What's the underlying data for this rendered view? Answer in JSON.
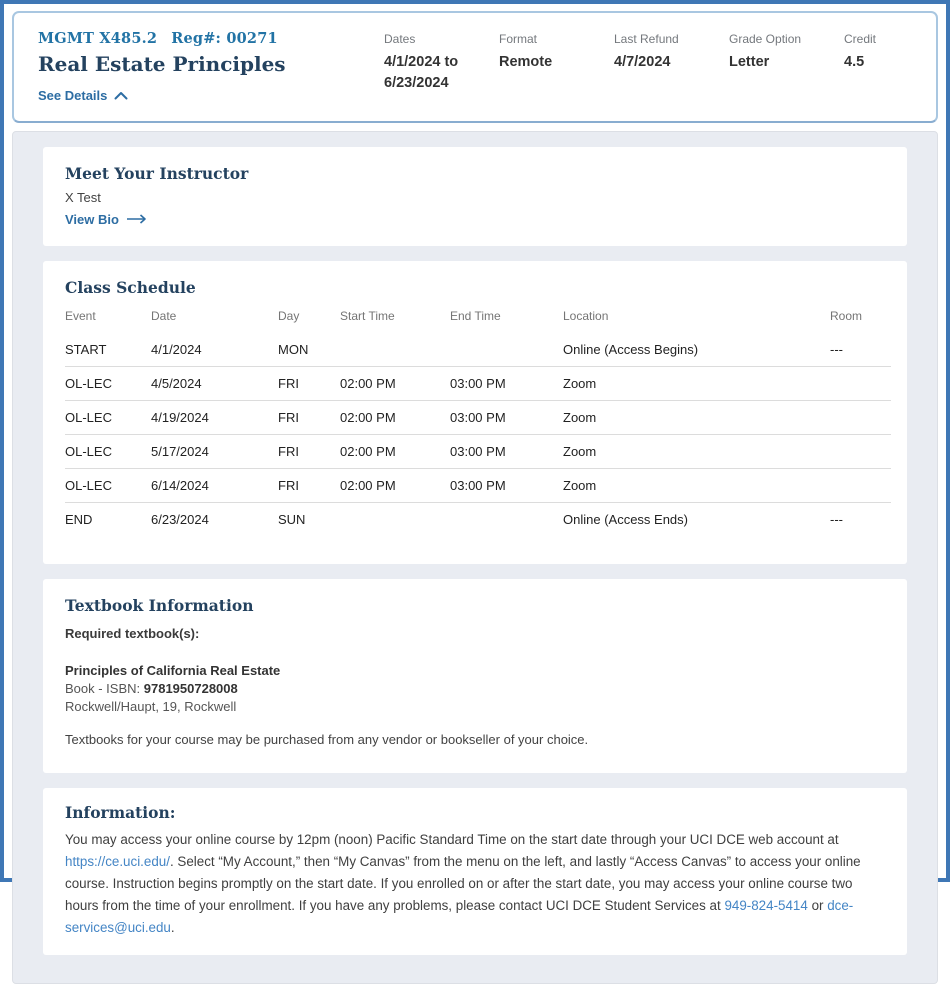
{
  "header": {
    "course_code": "MGMT X485.2",
    "reg_number": "Reg#: 00271",
    "course_title": "Real Estate Principles",
    "see_details_label": "See Details",
    "meta": [
      {
        "label": "Dates",
        "value": "4/1/2024 to 6/23/2024"
      },
      {
        "label": "Format",
        "value": "Remote"
      },
      {
        "label": "Last Refund",
        "value": "4/7/2024"
      },
      {
        "label": "Grade Option",
        "value": "Letter"
      },
      {
        "label": "Credit",
        "value": "4.5"
      }
    ]
  },
  "instructor": {
    "heading": "Meet Your Instructor",
    "name": "X Test",
    "view_bio_label": "View Bio"
  },
  "schedule": {
    "heading": "Class Schedule",
    "columns": [
      "Event",
      "Date",
      "Day",
      "Start Time",
      "End Time",
      "Location",
      "Room"
    ],
    "rows": [
      [
        "START",
        "4/1/2024",
        "MON",
        "",
        "",
        "Online (Access Begins)",
        "---"
      ],
      [
        "OL-LEC",
        "4/5/2024",
        "FRI",
        "02:00 PM",
        "03:00 PM",
        "Zoom",
        ""
      ],
      [
        "OL-LEC",
        "4/19/2024",
        "FRI",
        "02:00 PM",
        "03:00 PM",
        "Zoom",
        ""
      ],
      [
        "OL-LEC",
        "5/17/2024",
        "FRI",
        "02:00 PM",
        "03:00 PM",
        "Zoom",
        ""
      ],
      [
        "OL-LEC",
        "6/14/2024",
        "FRI",
        "02:00 PM",
        "03:00 PM",
        "Zoom",
        ""
      ],
      [
        "END",
        "6/23/2024",
        "SUN",
        "",
        "",
        "Online (Access Ends)",
        "---"
      ]
    ]
  },
  "textbook": {
    "heading": "Textbook Information",
    "required_label": "Required textbook(s):",
    "book_title": "Principles of California Real Estate",
    "isbn_label": "Book - ISBN: ",
    "isbn": "9781950728008",
    "author_line": "Rockwell/Haupt, 19, Rockwell",
    "note": "Textbooks for your course may be purchased from any vendor or bookseller of your choice."
  },
  "information": {
    "heading": "Information:",
    "text_1": "You may access your online course by 12pm (noon) Pacific Standard Time on the start date through your UCI DCE web account at ",
    "link_url": "https://ce.uci.edu/",
    "text_2": ". Select “My Account,” then “My Canvas” from the menu on the left, and lastly “Access Canvas” to access your online course. Instruction begins promptly on the start date. If you enrolled on or after the start date, you may access your online course two hours from the time of your enrollment. If you have any problems, please contact UCI DCE Student Services at ",
    "link_phone": "949-824-5414",
    "text_3": " or ",
    "link_email": "dce-services@uci.edu",
    "text_4": "."
  },
  "colors": {
    "outer_border": "#3f77b5",
    "header_card_border": "#a9c7e1",
    "panel_background": "#e9ecf2",
    "accent_blue": "#2d6da3",
    "course_code_blue": "#2273a5",
    "heading_navy": "#24425f",
    "link_blue": "#4485c5"
  }
}
